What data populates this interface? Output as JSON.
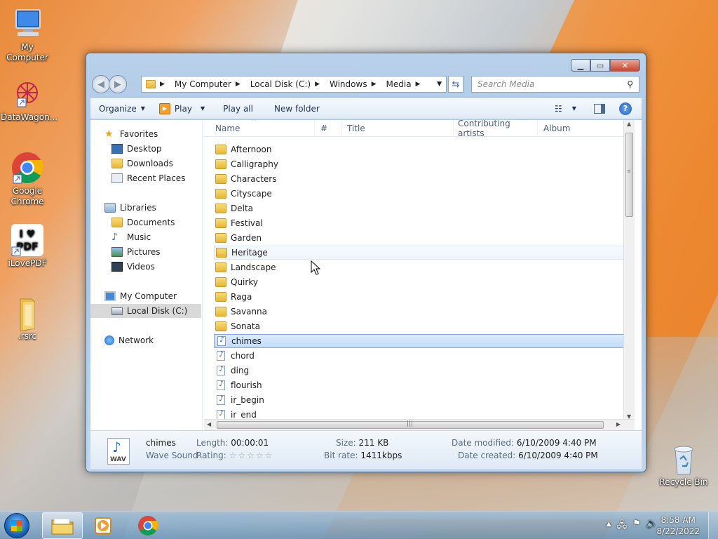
{
  "desktop": {
    "icons": [
      {
        "label": "My Computer",
        "icon": "computer-icon"
      },
      {
        "label": "DataWagon...",
        "icon": "datawagon-icon"
      },
      {
        "label": "Google Chrome",
        "icon": "chrome-icon"
      },
      {
        "label": "iLovePDF",
        "icon": "ilovepdf-icon"
      },
      {
        "label": ".rsrc",
        "icon": "folder-icon"
      },
      {
        "label": "Recycle Bin",
        "icon": "recycle-bin-icon"
      }
    ]
  },
  "window": {
    "breadcrumb": [
      "My Computer",
      "Local Disk (C:)",
      "Windows",
      "Media"
    ],
    "search_placeholder": "Search Media",
    "toolbar": {
      "organize": "Organize",
      "play": "Play",
      "play_all": "Play all",
      "new_folder": "New folder"
    },
    "nav": {
      "favorites": "Favorites",
      "favorites_items": [
        "Desktop",
        "Downloads",
        "Recent Places"
      ],
      "libraries": "Libraries",
      "libraries_items": [
        "Documents",
        "Music",
        "Pictures",
        "Videos"
      ],
      "computer": "My Computer",
      "computer_items": [
        "Local Disk (C:)"
      ],
      "network": "Network"
    },
    "columns": [
      "Name",
      "#",
      "Title",
      "Contributing artists",
      "Album"
    ],
    "items": [
      {
        "name": "Afternoon",
        "type": "folder"
      },
      {
        "name": "Calligraphy",
        "type": "folder"
      },
      {
        "name": "Characters",
        "type": "folder"
      },
      {
        "name": "Cityscape",
        "type": "folder"
      },
      {
        "name": "Delta",
        "type": "folder"
      },
      {
        "name": "Festival",
        "type": "folder"
      },
      {
        "name": "Garden",
        "type": "folder"
      },
      {
        "name": "Heritage",
        "type": "folder"
      },
      {
        "name": "Landscape",
        "type": "folder"
      },
      {
        "name": "Quirky",
        "type": "folder"
      },
      {
        "name": "Raga",
        "type": "folder"
      },
      {
        "name": "Savanna",
        "type": "folder"
      },
      {
        "name": "Sonata",
        "type": "folder"
      },
      {
        "name": "chimes",
        "type": "wav"
      },
      {
        "name": "chord",
        "type": "wav"
      },
      {
        "name": "ding",
        "type": "wav"
      },
      {
        "name": "flourish",
        "type": "midi"
      },
      {
        "name": "ir_begin",
        "type": "wav"
      },
      {
        "name": "ir_end",
        "type": "wav"
      }
    ],
    "hovered_item": "Heritage",
    "selected_item": "chimes",
    "details": {
      "icon_label": "WAV",
      "name": "chimes",
      "type": "Wave Sound",
      "length_label": "Length:",
      "length": "00:00:01",
      "rating_label": "Rating:",
      "rating": "☆☆☆☆☆",
      "size_label": "Size:",
      "size": "211 KB",
      "bitrate_label": "Bit rate:",
      "bitrate": "1411kbps",
      "modified_label": "Date modified:",
      "modified": "6/10/2009 4:40 PM",
      "created_label": "Date created:",
      "created": "6/10/2009 4:40 PM"
    }
  },
  "taskbar": {
    "time": "8:58 AM",
    "date": "8/22/2022"
  }
}
